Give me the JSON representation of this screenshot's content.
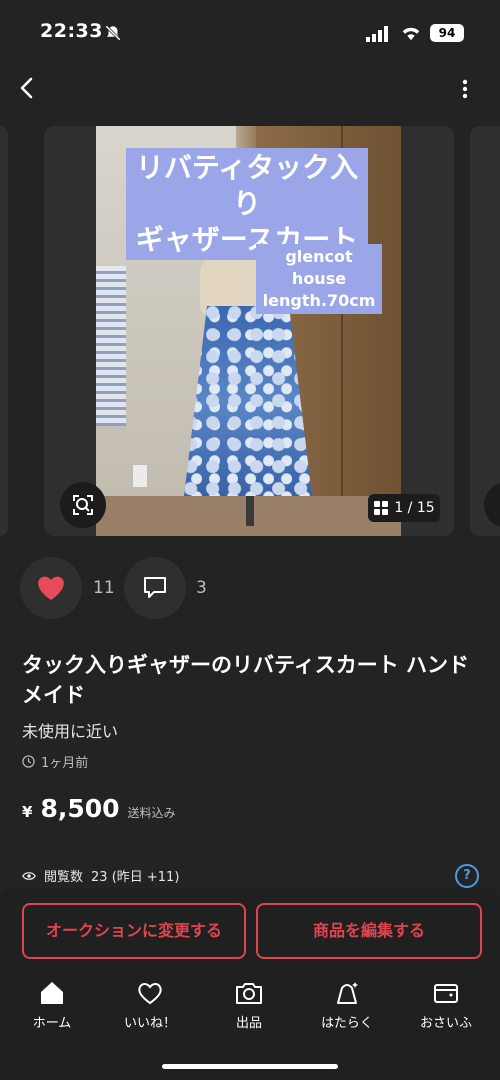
{
  "status_bar": {
    "time": "22:33",
    "battery": "94"
  },
  "gallery": {
    "overlay_title_line1": "リバティタック入り",
    "overlay_title_line2": "ギャザースカート",
    "overlay_brand": "glencot house",
    "overlay_length": "length.70cm",
    "counter": "1 / 15"
  },
  "actions": {
    "likes": "11",
    "comments": "3"
  },
  "item": {
    "title": "タック入りギャザーのリバティスカート ハンドメイド",
    "condition": "未使用に近い",
    "posted": "1ヶ月前",
    "price_symbol": "¥",
    "price": "8,500",
    "shipping": "送料込み",
    "views_label": "閲覧数",
    "views_value": "23 (昨日 +11)"
  },
  "buttons": {
    "auction": "オークションに変更する",
    "edit": "商品を編集する"
  },
  "nav": {
    "home": "ホーム",
    "likes": "いいね！",
    "sell": "出品",
    "work": "はたらく",
    "wallet": "おさいふ"
  },
  "colors": {
    "accent": "#e04450",
    "like": "#e84a5a",
    "help": "#4d9be6",
    "overlay": "#9aa6e8"
  },
  "icons": [
    "bell-slash-icon",
    "signal-icon",
    "wifi-icon",
    "battery-icon",
    "back-icon",
    "more-icon",
    "lens-icon",
    "grid-icon",
    "heart-icon",
    "comment-icon",
    "clock-icon",
    "eye-icon",
    "help-icon",
    "home-icon",
    "heart-outline-icon",
    "camera-icon",
    "bag-icon",
    "wallet-icon"
  ]
}
